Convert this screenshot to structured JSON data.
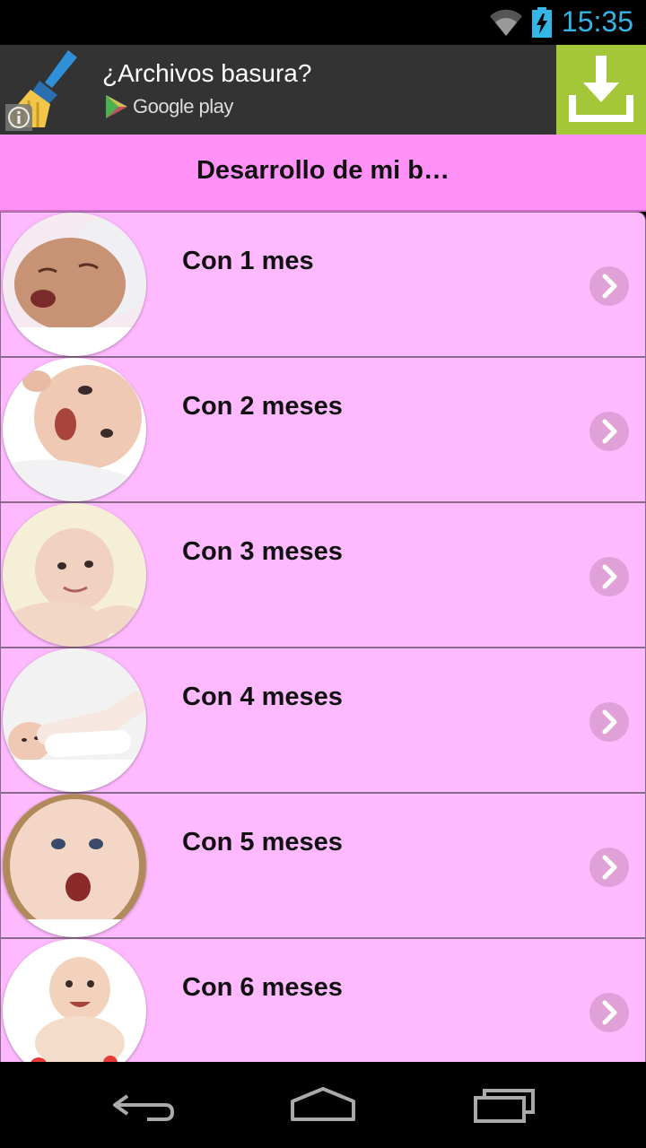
{
  "status_bar": {
    "time": "15:35",
    "icons": [
      "wifi-icon",
      "battery-charging-icon"
    ],
    "clock_color": "#33b5e5"
  },
  "ad": {
    "title": "¿Archivos basura?",
    "store_label": "Google play",
    "icons": [
      "cleaner-broom-icon",
      "info-icon",
      "google-play-icon",
      "download-icon"
    ],
    "download_color": "#a4c639"
  },
  "header": {
    "title": "Desarrollo de mi b…",
    "background": "#ff91f7"
  },
  "list": {
    "row_background": "#ffbaff",
    "items": [
      {
        "label": "Con 1 mes",
        "image": "baby-photo-1"
      },
      {
        "label": "Con 2 meses",
        "image": "baby-photo-2"
      },
      {
        "label": "Con 3 meses",
        "image": "baby-photo-3"
      },
      {
        "label": "Con 4 meses",
        "image": "baby-photo-4"
      },
      {
        "label": "Con 5 meses",
        "image": "baby-photo-5"
      },
      {
        "label": "Con 6 meses",
        "image": "baby-photo-6"
      }
    ]
  },
  "nav_bar": {
    "icons": [
      "back-icon",
      "home-icon",
      "recents-icon"
    ]
  }
}
